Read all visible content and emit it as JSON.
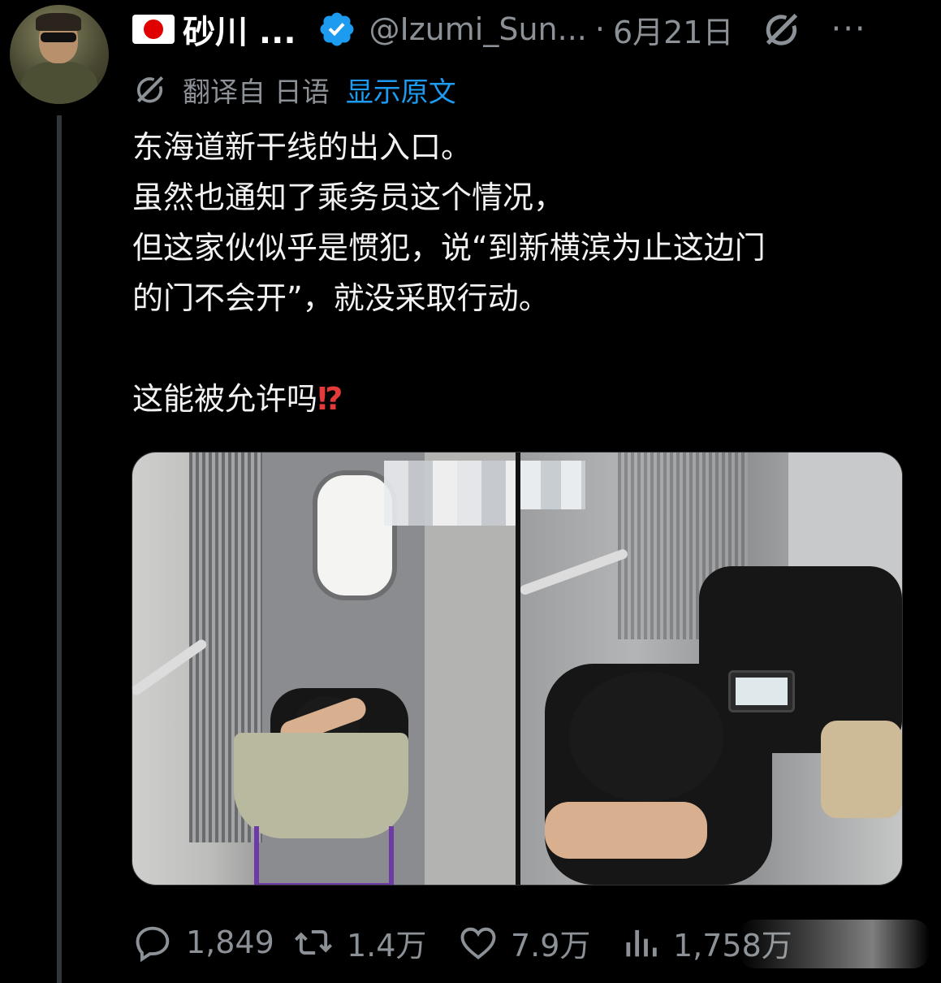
{
  "tweet": {
    "author": {
      "flag": "jp-flag-icon",
      "display_name": "砂川 ...",
      "handle": "@Izumi_Sun...",
      "verified": true
    },
    "separator": "·",
    "date": "6月21日",
    "more": "···",
    "translation": {
      "label": "翻译自 日语",
      "show_original": "显示原文"
    },
    "text_lines": [
      "东海道新干线的出入口。",
      "虽然也通知了乘务员这个情况，",
      "但这家伙似乎是惯犯，说“到新横滨为止这边门",
      "的门不会开”，就没采取行动。",
      "",
      "这能被允许吗"
    ],
    "emoji": "⁉",
    "media": {
      "count": 2,
      "items": [
        "train-door-photo-left",
        "train-door-photo-right"
      ]
    },
    "actions": {
      "replies": "1,849",
      "retweets": "1.4万",
      "likes": "7.9万",
      "views": "1,758万"
    }
  },
  "colors": {
    "background": "#000000",
    "text": "#e7e9ea",
    "muted": "#8b9196",
    "link": "#1d9bf0",
    "verified": "#1d9bf0",
    "emoji": "#e53a3a"
  }
}
